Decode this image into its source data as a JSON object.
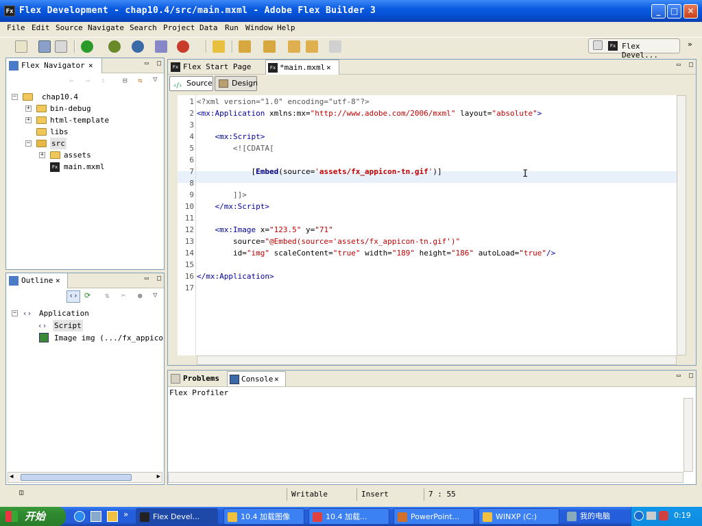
{
  "window": {
    "title": "Flex Development - chap10.4/src/main.mxml - Adobe Flex Builder 3",
    "app_icon": "Fx"
  },
  "menu": [
    "File",
    "Edit",
    "Source",
    "Navigate",
    "Search",
    "Project",
    "Data",
    "Run",
    "Window",
    "Help"
  ],
  "perspective": {
    "label": "Flex Devel..."
  },
  "navigator": {
    "tab": "Flex Navigator",
    "items": [
      {
        "label": "chap10.4",
        "indent": 0,
        "expand": "−",
        "kind": "project"
      },
      {
        "label": "bin-debug",
        "indent": 1,
        "expand": "+",
        "kind": "folder"
      },
      {
        "label": "html-template",
        "indent": 1,
        "expand": "+",
        "kind": "folder"
      },
      {
        "label": "libs",
        "indent": 1,
        "expand": "",
        "kind": "folder"
      },
      {
        "label": "src",
        "indent": 1,
        "expand": "−",
        "kind": "folder"
      },
      {
        "label": "assets",
        "indent": 2,
        "expand": "+",
        "kind": "folder"
      },
      {
        "label": "main.mxml",
        "indent": 2,
        "expand": "",
        "kind": "file"
      }
    ]
  },
  "outline": {
    "tab": "Outline",
    "items": [
      {
        "label": "Application",
        "indent": 0
      },
      {
        "label": "Script",
        "indent": 1
      },
      {
        "label": "Image img (.../fx_appicon-t",
        "indent": 1
      }
    ]
  },
  "editor": {
    "tabs": [
      "Flex Start Page",
      "*main.mxml"
    ],
    "modes": [
      "Source",
      "Design"
    ],
    "lines": [
      "1",
      "2",
      "3",
      "4",
      "5",
      "6",
      "7",
      "8",
      "9",
      "10",
      "11",
      "12",
      "13",
      "14",
      "15",
      "16",
      "17"
    ]
  },
  "bottom": {
    "tabs": [
      "Problems",
      "Console"
    ],
    "title": "Flex Profiler"
  },
  "status": {
    "writable": "Writable",
    "insert": "Insert",
    "position": "7 : 55"
  },
  "taskbar": {
    "start": "开始",
    "tasks": [
      "Flex Devel...",
      "10.4 加载图像",
      "10.4 加载...",
      "PowerPoint...",
      "WINXP (C:)",
      "我的电脑"
    ],
    "clock": "0:19"
  },
  "colors": {
    "tag": "#0000a0",
    "value": "#c00000",
    "title_bar": "#0450d4",
    "taskbar": "#245edb",
    "start": "#2f8b2f"
  }
}
